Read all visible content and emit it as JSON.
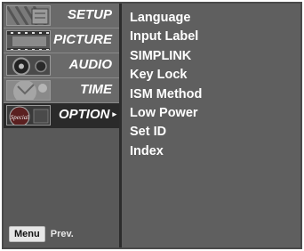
{
  "menu": [
    {
      "label": "SETUP",
      "icon": "setup-thumbnail-icon",
      "selected": false
    },
    {
      "label": "PICTURE",
      "icon": "picture-thumbnail-icon",
      "selected": false
    },
    {
      "label": "AUDIO",
      "icon": "audio-thumbnail-icon",
      "selected": false
    },
    {
      "label": "TIME",
      "icon": "time-thumbnail-icon",
      "selected": false
    },
    {
      "label": "OPTION",
      "icon": "special-thumbnail-icon",
      "selected": true
    }
  ],
  "selected_arrow": "▸",
  "options": [
    "Language",
    "Input Label",
    "SIMPLINK",
    "Key Lock",
    "ISM Method",
    "Low Power",
    "Set ID",
    "Index"
  ],
  "footer": {
    "key": "Menu",
    "label": "Prev."
  },
  "thumbnail_stamp_text": "Special",
  "colors": {
    "panel": "#5f5f5f",
    "selected": "#2a2a2a",
    "text": "#ffffff"
  }
}
